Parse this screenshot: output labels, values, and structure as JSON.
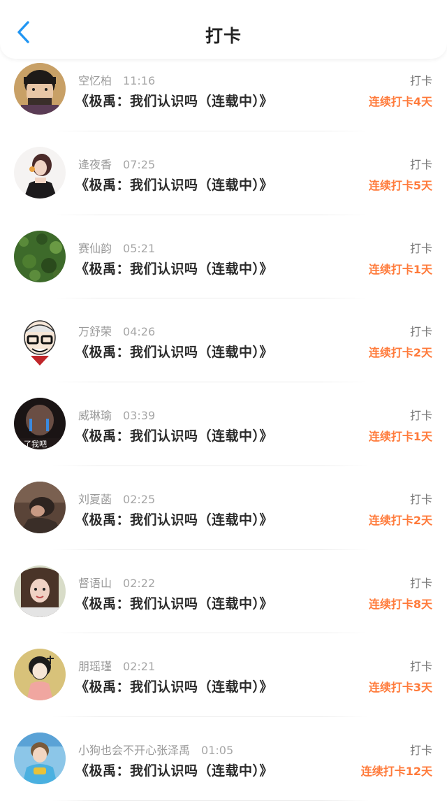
{
  "header": {
    "title": "打卡",
    "back_icon": "chevron-left-icon",
    "accent_color": "#2196f3"
  },
  "entries": [
    {
      "name": "空忆柏",
      "time": "11:16",
      "book": "《极禹：我们认识吗（连载中）》",
      "action": "打卡",
      "streak": "连续打卡4天",
      "avatar_icon": "avatar-photo"
    },
    {
      "name": "逄夜香",
      "time": "07:25",
      "book": "《极禹：我们认识吗（连载中）》",
      "action": "打卡",
      "streak": "连续打卡5天",
      "avatar_icon": "avatar-photo"
    },
    {
      "name": "赛仙韵",
      "time": "05:21",
      "book": "《极禹：我们认识吗（连载中）》",
      "action": "打卡",
      "streak": "连续打卡1天",
      "avatar_icon": "avatar-photo"
    },
    {
      "name": "万舒荣",
      "time": "04:26",
      "book": "《极禹：我们认识吗（连载中）》",
      "action": "打卡",
      "streak": "连续打卡2天",
      "avatar_icon": "avatar-cartoon"
    },
    {
      "name": "威琳瑜",
      "time": "03:39",
      "book": "《极禹：我们认识吗（连载中）》",
      "action": "打卡",
      "streak": "连续打卡1天",
      "avatar_icon": "avatar-photo",
      "avatar_caption": "了我吧"
    },
    {
      "name": "刘夏菡",
      "time": "02:25",
      "book": "《极禹：我们认识吗（连载中）》",
      "action": "打卡",
      "streak": "连续打卡2天",
      "avatar_icon": "avatar-photo"
    },
    {
      "name": "督语山",
      "time": "02:22",
      "book": "《极禹：我们认识吗（连载中）》",
      "action": "打卡",
      "streak": "连续打卡8天",
      "avatar_icon": "avatar-photo"
    },
    {
      "name": "朋瑶瑾",
      "time": "02:21",
      "book": "《极禹：我们认识吗（连载中）》",
      "action": "打卡",
      "streak": "连续打卡3天",
      "avatar_icon": "avatar-cartoon"
    },
    {
      "name": "小狗也会不开心张泽禹",
      "time": "01:05",
      "book": "《极禹：我们认识吗（连载中）》",
      "action": "打卡",
      "streak": "连续打卡12天",
      "avatar_icon": "avatar-photo"
    }
  ],
  "colors": {
    "streak": "#ff7a3a",
    "meta": "#9a9a9a",
    "title": "#222222"
  }
}
